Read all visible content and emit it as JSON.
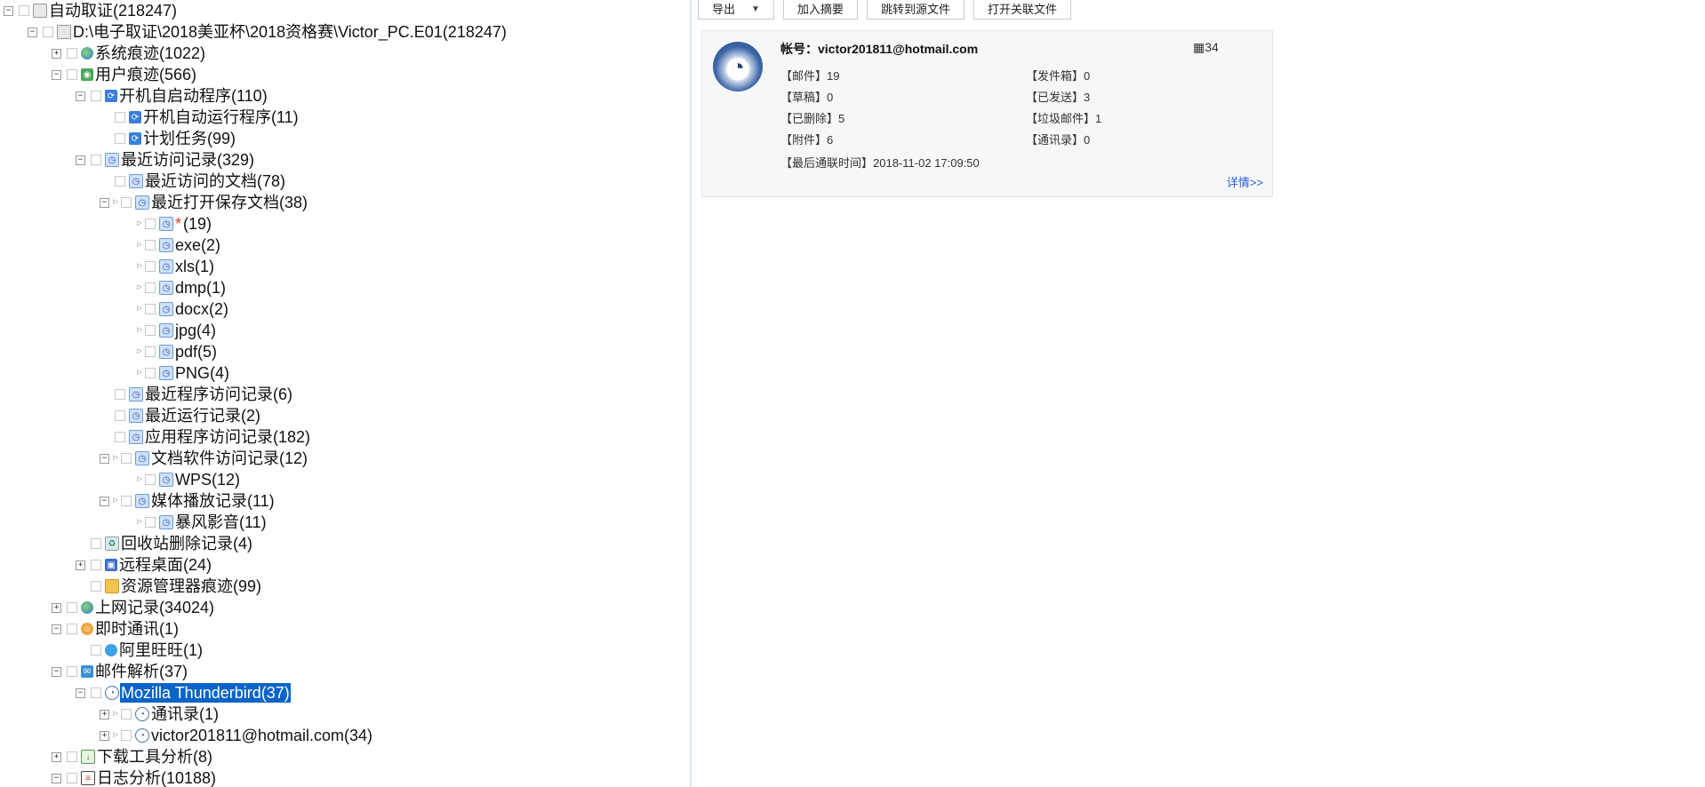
{
  "tree": [
    {
      "id": "n0",
      "label": "自动取证(218247)",
      "expander": "minus",
      "icon": "disk",
      "icon_char": ""
    },
    {
      "id": "n1",
      "label": "D:\\电子取证\\2018美亚杯\\2018资格赛\\Victor_PC.E01(218247)",
      "expander": "minus",
      "icon": "disk",
      "icon_char": ""
    },
    {
      "id": "n2",
      "label": "系统痕迹(1022)",
      "expander": "plus",
      "icon": "globe",
      "icon_char": ""
    },
    {
      "id": "n3",
      "label": "用户痕迹(566)",
      "expander": "minus",
      "icon": "green",
      "icon_char": "◉"
    },
    {
      "id": "n4",
      "label": "开机自启动程序(110)",
      "expander": "minus",
      "icon": "sched",
      "icon_char": "⟳"
    },
    {
      "id": "n5",
      "label": "开机自动运行程序(11)",
      "expander": "none",
      "icon": "sched",
      "icon_char": "⟳"
    },
    {
      "id": "n6",
      "label": "计划任务(99)",
      "expander": "none",
      "icon": "sched",
      "icon_char": "⟳"
    },
    {
      "id": "n7",
      "label": "最近访问记录(329)",
      "expander": "minus",
      "icon": "blue",
      "icon_char": "◷"
    },
    {
      "id": "n8",
      "label": "最近访问的文档(78)",
      "expander": "none",
      "icon": "blue",
      "icon_char": "◷"
    },
    {
      "id": "n9",
      "label": "最近打开保存文档(38)",
      "expander": "minus",
      "icon": "blue",
      "icon_char": "◷"
    },
    {
      "id": "n10",
      "label": "(19)",
      "star": "*",
      "expander": "none",
      "icon": "blue",
      "icon_char": "◷"
    },
    {
      "id": "n11",
      "label": "exe(2)",
      "expander": "none",
      "icon": "blue",
      "icon_char": "◷"
    },
    {
      "id": "n12",
      "label": "xls(1)",
      "expander": "none",
      "icon": "blue",
      "icon_char": "◷"
    },
    {
      "id": "n13",
      "label": "dmp(1)",
      "expander": "none",
      "icon": "blue",
      "icon_char": "◷"
    },
    {
      "id": "n14",
      "label": "docx(2)",
      "expander": "none",
      "icon": "blue",
      "icon_char": "◷"
    },
    {
      "id": "n15",
      "label": "jpg(4)",
      "expander": "none",
      "icon": "blue",
      "icon_char": "◷"
    },
    {
      "id": "n16",
      "label": "pdf(5)",
      "expander": "none",
      "icon": "blue",
      "icon_char": "◷"
    },
    {
      "id": "n17",
      "label": "PNG(4)",
      "expander": "none",
      "icon": "blue",
      "icon_char": "◷"
    },
    {
      "id": "n18",
      "label": "最近程序访问记录(6)",
      "expander": "none",
      "icon": "blue",
      "icon_char": "◷"
    },
    {
      "id": "n19",
      "label": "最近运行记录(2)",
      "expander": "none",
      "icon": "blue",
      "icon_char": "◷"
    },
    {
      "id": "n20",
      "label": "应用程序访问记录(182)",
      "expander": "none",
      "icon": "blue",
      "icon_char": "◷"
    },
    {
      "id": "n21",
      "label": "文档软件访问记录(12)",
      "expander": "minus",
      "icon": "blue",
      "icon_char": "◷"
    },
    {
      "id": "n22",
      "label": "WPS(12)",
      "expander": "none",
      "icon": "blue",
      "icon_char": "◷"
    },
    {
      "id": "n23",
      "label": "媒体播放记录(11)",
      "expander": "minus",
      "icon": "blue",
      "icon_char": "◷"
    },
    {
      "id": "n24",
      "label": "暴风影音(11)",
      "expander": "none",
      "icon": "blue",
      "icon_char": "◷"
    },
    {
      "id": "n25",
      "label": "回收站删除记录(4)",
      "expander": "none",
      "icon": "recycle",
      "icon_char": "♻"
    },
    {
      "id": "n26",
      "label": "远程桌面(24)",
      "expander": "plus",
      "icon": "remote",
      "icon_char": "▣"
    },
    {
      "id": "n27",
      "label": "资源管理器痕迹(99)",
      "expander": "none",
      "icon": "folder",
      "icon_char": ""
    },
    {
      "id": "n28",
      "label": "上网记录(34024)",
      "expander": "plus",
      "icon": "globe",
      "icon_char": ""
    },
    {
      "id": "n29",
      "label": "即时通讯(1)",
      "expander": "minus",
      "icon": "people",
      "icon_char": "☺"
    },
    {
      "id": "n30",
      "label": "阿里旺旺(1)",
      "expander": "none",
      "icon": "tea",
      "icon_char": ""
    },
    {
      "id": "n31",
      "label": "邮件解析(37)",
      "expander": "minus",
      "icon": "mail",
      "icon_char": "✉"
    },
    {
      "id": "n32",
      "label": "Mozilla Thunderbird(37)",
      "expander": "minus",
      "icon": "bird",
      "icon_char": "◔",
      "selected": true
    },
    {
      "id": "n33",
      "label": "通讯录(1)",
      "expander": "plus",
      "icon": "bird",
      "icon_char": "◔"
    },
    {
      "id": "n34",
      "label": "victor201811@hotmail.com(34)",
      "expander": "plus",
      "icon": "bird",
      "icon_char": "◔"
    },
    {
      "id": "n35",
      "label": "下载工具分析(8)",
      "expander": "plus",
      "icon": "dl",
      "icon_char": "↓"
    },
    {
      "id": "n36",
      "label": "日志分析(10188)",
      "expander": "minus",
      "icon": "log",
      "icon_char": "≡"
    }
  ],
  "toolbar": {
    "export_label": "导出",
    "add_summary_label": "加入摘要",
    "goto_source_label": "跳转到源文件",
    "open_related_label": "打开关联文件"
  },
  "card": {
    "account_label": "帐号：",
    "account_value": "victor201811@hotmail.com",
    "count": "34",
    "fields": [
      {
        "label": "【邮件】",
        "value": "19"
      },
      {
        "label": "【发件箱】",
        "value": "0"
      },
      {
        "label": "【草稿】",
        "value": "0"
      },
      {
        "label": "【已发送】",
        "value": "3"
      },
      {
        "label": "【已删除】",
        "value": "5"
      },
      {
        "label": "【垃圾邮件】",
        "value": "1"
      },
      {
        "label": "【附件】",
        "value": "6"
      },
      {
        "label": "【通讯录】",
        "value": "0"
      }
    ],
    "last_contact_label": "【最后通联时间】",
    "last_contact_value": "2018-11-02 17:09:50",
    "detail_link": "详情>>"
  }
}
